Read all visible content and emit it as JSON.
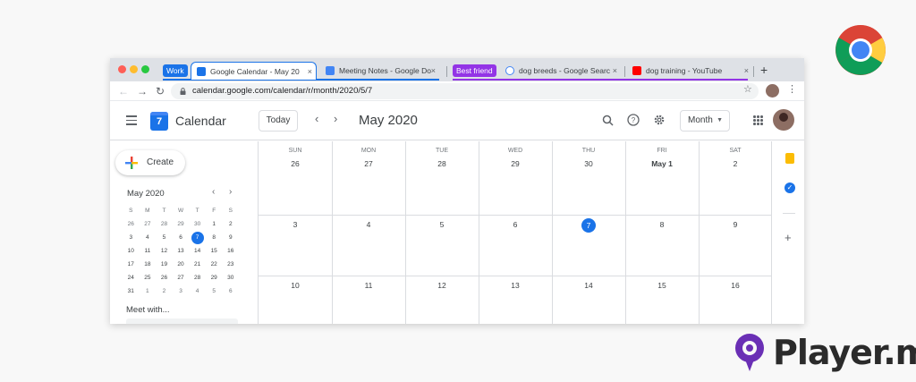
{
  "browser": {
    "tab_groups": [
      {
        "label": "Work",
        "color": "#1a73e8"
      },
      {
        "label": "Best friend",
        "color": "#9334e6"
      }
    ],
    "tabs": [
      {
        "title": "Google Calendar - May 20",
        "icon": "calendar-icon",
        "active": true
      },
      {
        "title": "Meeting Notes - Google Do",
        "icon": "docs-icon",
        "active": false
      },
      {
        "title": "dog breeds - Google Searc",
        "icon": "google-icon",
        "active": false
      },
      {
        "title": "dog training - YouTube",
        "icon": "youtube-icon",
        "active": false
      }
    ],
    "close_glyph": "×",
    "newtab_glyph": "+",
    "url": "calendar.google.com/calendar/r/month/2020/5/7"
  },
  "calendar": {
    "app_name": "Calendar",
    "logo_day": "7",
    "today_label": "Today",
    "month_title": "May 2020",
    "view_label": "Month",
    "create_label": "Create",
    "mini": {
      "title": "May 2020",
      "dow": [
        "S",
        "M",
        "T",
        "W",
        "T",
        "F",
        "S"
      ],
      "weeks": [
        [
          "26",
          "27",
          "28",
          "29",
          "30",
          "1",
          "2"
        ],
        [
          "3",
          "4",
          "5",
          "6",
          "7",
          "8",
          "9"
        ],
        [
          "10",
          "11",
          "12",
          "13",
          "14",
          "15",
          "16"
        ],
        [
          "17",
          "18",
          "19",
          "20",
          "21",
          "22",
          "23"
        ],
        [
          "24",
          "25",
          "26",
          "27",
          "28",
          "29",
          "30"
        ],
        [
          "31",
          "1",
          "2",
          "3",
          "4",
          "5",
          "6"
        ]
      ],
      "selected": "7"
    },
    "meet_label": "Meet with...",
    "grid": {
      "dow": [
        "SUN",
        "MON",
        "TUE",
        "WED",
        "THU",
        "FRI",
        "SAT"
      ],
      "weeks": [
        [
          "26",
          "27",
          "28",
          "29",
          "30",
          "May 1",
          "2"
        ],
        [
          "3",
          "4",
          "5",
          "6",
          "7",
          "8",
          "9"
        ],
        [
          "10",
          "11",
          "12",
          "13",
          "14",
          "15",
          "16"
        ]
      ],
      "today": "7"
    }
  },
  "branding": {
    "watermark": "Player.me",
    "accent": "#6a2fb5"
  }
}
